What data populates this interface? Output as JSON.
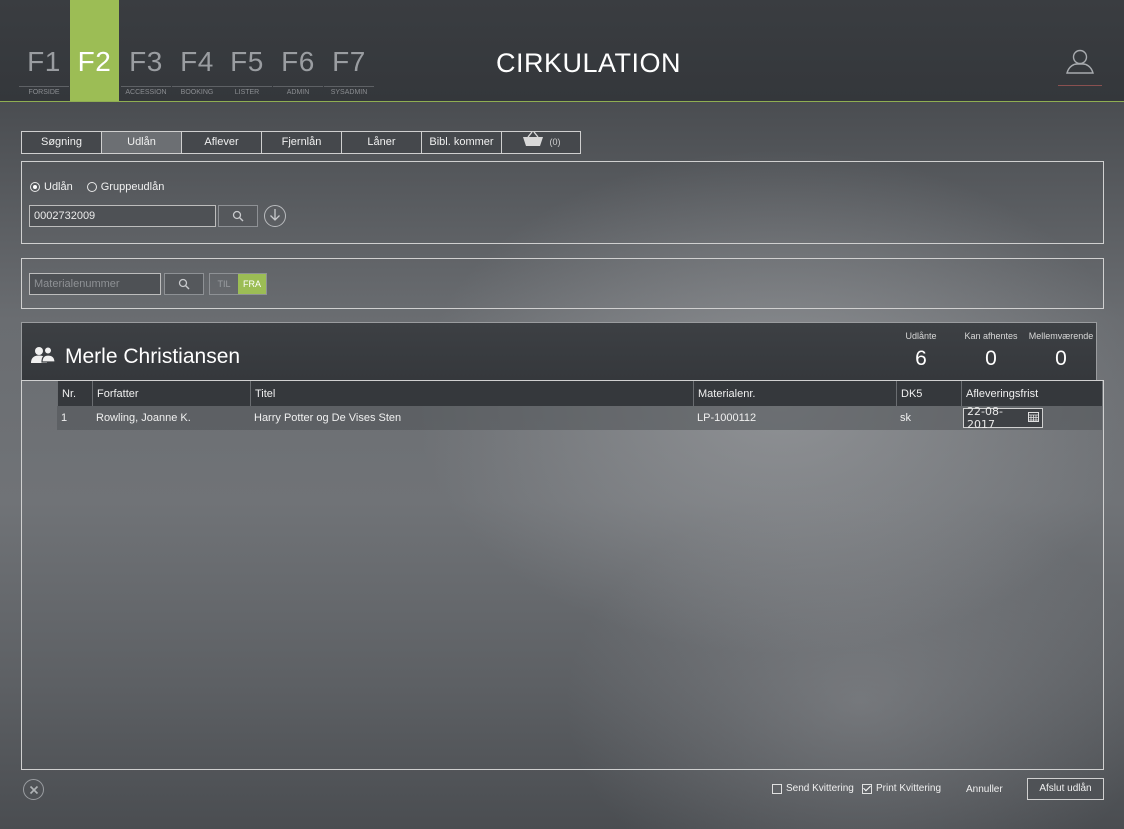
{
  "app": {
    "title": "CIRKULATION"
  },
  "fkeys": [
    {
      "key": "F1",
      "label": "FORSIDE",
      "active": false
    },
    {
      "key": "F2",
      "label": "",
      "active": true
    },
    {
      "key": "F3",
      "label": "ACCESSION",
      "active": false
    },
    {
      "key": "F4",
      "label": "BOOKING",
      "active": false
    },
    {
      "key": "F5",
      "label": "LISTER",
      "active": false
    },
    {
      "key": "F6",
      "label": "ADMIN",
      "active": false
    },
    {
      "key": "F7",
      "label": "SYSADMIN",
      "active": false
    }
  ],
  "tabs": [
    {
      "label": "Søgning",
      "active": false
    },
    {
      "label": "Udlån",
      "active": true
    },
    {
      "label": "Aflever",
      "active": false
    },
    {
      "label": "Fjernlån",
      "active": false
    },
    {
      "label": "Låner",
      "active": false
    },
    {
      "label": "Bibl. kommer",
      "active": false
    }
  ],
  "basket": {
    "count": "(0)",
    "icon": "basket-icon"
  },
  "loan_type": {
    "option1": "Udlån",
    "option2": "Gruppeudlån",
    "selected": "Udlån"
  },
  "borrower_search": {
    "value": "0002732009"
  },
  "material_search": {
    "placeholder": "Materialenummer",
    "toggle_til": "TIL",
    "toggle_fra": "FRA",
    "toggle_selected": "FRA"
  },
  "borrower": {
    "name": "Merle Christiansen",
    "stats": [
      {
        "label": "Udlånte",
        "value": "6"
      },
      {
        "label": "Kan afhentes",
        "value": "0"
      },
      {
        "label": "Mellemværende",
        "value": "0"
      }
    ]
  },
  "table": {
    "columns": [
      "Nr.",
      "Forfatter",
      "Titel",
      "Materialenr.",
      "DK5",
      "Afleveringsfrist"
    ],
    "rows": [
      {
        "nr": "1",
        "author": "Rowling, Joanne K.",
        "title": "Harry Potter og De Vises Sten",
        "material": "LP-1000112",
        "dk5": "sk",
        "due": "22-08-2017"
      }
    ]
  },
  "footer": {
    "send_receipt": "Send Kvittering",
    "send_receipt_checked": false,
    "print_receipt": "Print Kvittering",
    "print_receipt_checked": true,
    "cancel": "Annuller",
    "finish": "Afslut udlån"
  },
  "colors": {
    "accent": "#9cbd55",
    "topbar": "#36393d"
  }
}
